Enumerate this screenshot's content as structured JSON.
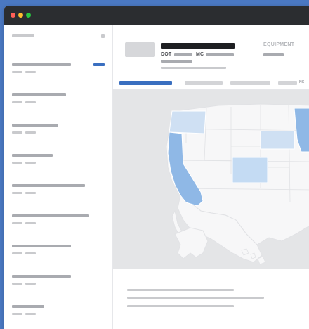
{
  "window": {
    "controls": [
      "close",
      "minimize",
      "maximize"
    ]
  },
  "sidebar": {
    "header_placeholder": "",
    "items": [
      {
        "label": "",
        "badge": true
      },
      {
        "label": "",
        "badge": false
      },
      {
        "label": "",
        "badge": false
      },
      {
        "label": "",
        "badge": false
      },
      {
        "label": "",
        "badge": false
      },
      {
        "label": "",
        "badge": false
      },
      {
        "label": "",
        "badge": false
      },
      {
        "label": "",
        "badge": false
      },
      {
        "label": "",
        "badge": false
      }
    ]
  },
  "carrier": {
    "dot_label": "DOT",
    "mc_label": "MC",
    "equipment_title": "EQUIPMENT"
  },
  "tabs": {
    "truncated_label": "NC"
  },
  "map": {
    "highlight_color": "#8fb8e6",
    "light_highlight_color": "#cfe0f3",
    "land_color": "#f7f7f8",
    "water_color": "#e4e5e7"
  },
  "colors": {
    "accent": "#3a6fc0",
    "titlebar": "#2b2d30",
    "background": "#4a78c2"
  }
}
